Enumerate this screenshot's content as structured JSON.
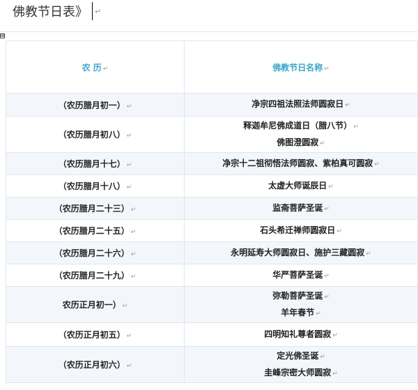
{
  "document": {
    "title": "佛教节日表》",
    "para_mark": "↵",
    "table_handle": "⊞"
  },
  "table": {
    "headers": [
      "农  历",
      "佛教节日名称"
    ],
    "rows": [
      {
        "date": "（农历腊月初一）",
        "lines": [
          "净宗四祖法照法师圆寂日"
        ]
      },
      {
        "date": "（农历腊月初八）",
        "lines": [
          "释迦牟尼佛成道日（腊八节）",
          "佛图澄圆寂"
        ]
      },
      {
        "date": "（农历腊月十七）",
        "lines": [
          "净宗十二祖彻悟法师圆寂、紫柏真可圆寂"
        ]
      },
      {
        "date": "（农历腊月十八）",
        "lines": [
          "太虚大师诞辰日"
        ]
      },
      {
        "date": "（农历腊月二十三）",
        "lines": [
          "监斋菩萨圣诞"
        ]
      },
      {
        "date": "（农历腊月二十五）",
        "lines": [
          "石头希迁禅师圆寂日"
        ]
      },
      {
        "date": "（农历腊月二十六）",
        "lines": [
          "永明延寿大师圆寂日、施护三藏圆寂"
        ]
      },
      {
        "date": "（农历腊月二十九）",
        "lines": [
          "华严菩萨圣诞"
        ]
      },
      {
        "date": "农历正月初一）",
        "lines": [
          "弥勒菩萨圣诞",
          "羊年春节"
        ]
      },
      {
        "date": "（农历正月初五）",
        "lines": [
          "四明知礼尊者圆寂"
        ]
      },
      {
        "date": "（农历正月初六）",
        "lines": [
          "定光佛圣诞",
          "圭峰宗密大师圆寂"
        ]
      }
    ]
  }
}
